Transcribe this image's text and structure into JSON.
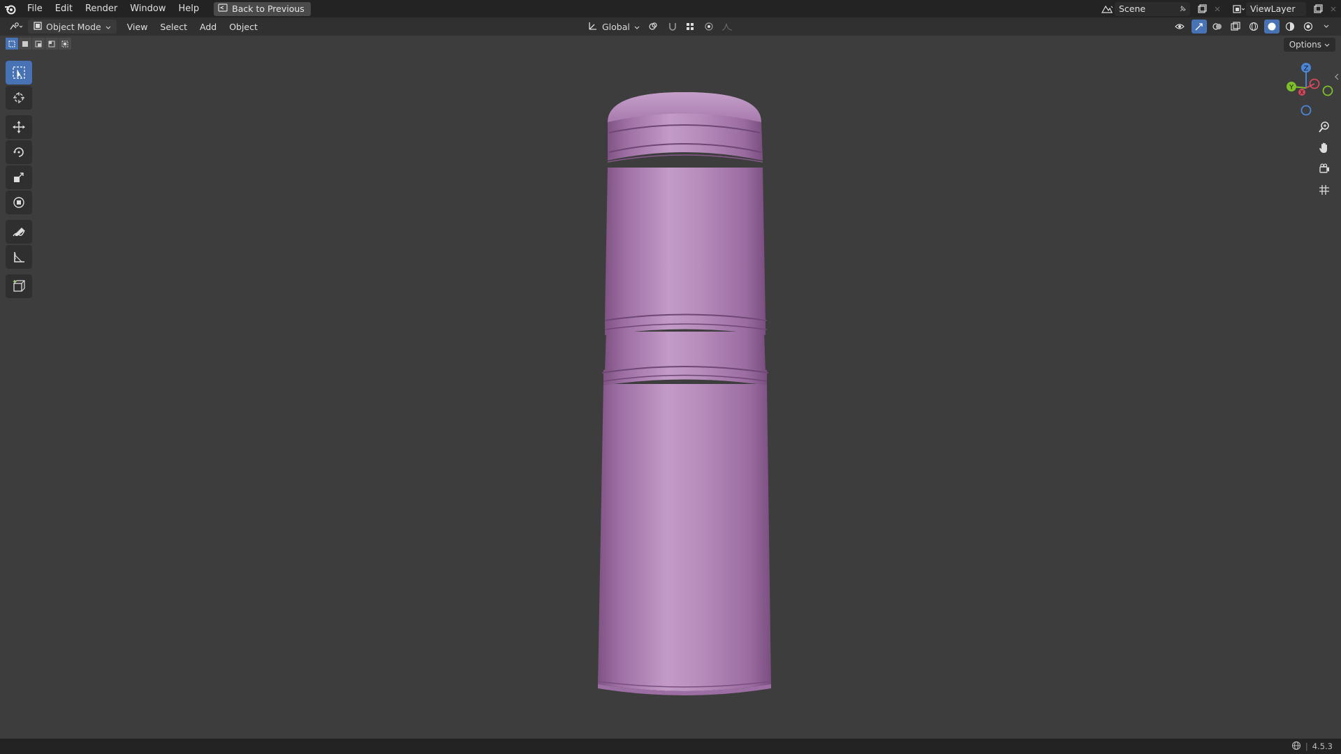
{
  "topbar": {
    "menus": [
      "File",
      "Edit",
      "Render",
      "Window",
      "Help"
    ],
    "back_label": "Back to Previous",
    "scene_label": "Scene",
    "viewlayer_label": "ViewLayer"
  },
  "header": {
    "mode": "Object Mode",
    "menus": [
      "View",
      "Select",
      "Add",
      "Object"
    ],
    "orientation": "Global"
  },
  "options_label": "Options",
  "gizmo": {
    "z": "Z",
    "y": "Y",
    "x": "X"
  },
  "status": {
    "version": "4.5.3"
  },
  "colors": {
    "accent": "#4772b3",
    "model": "#b07fb7",
    "background": "#3d3d3d"
  }
}
